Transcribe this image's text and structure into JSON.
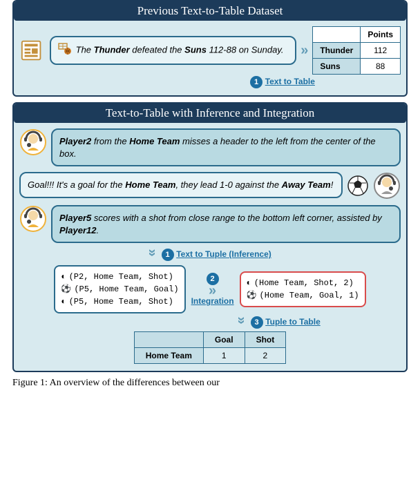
{
  "top": {
    "header": "Previous Text-to-Table Dataset",
    "speech_parts": [
      "The ",
      "Thunder",
      " defeated the ",
      "Suns",
      " 112-88 on Sunday."
    ],
    "table": {
      "col": "Points",
      "rows": [
        {
          "team": "Thunder",
          "pts": "112"
        },
        {
          "team": "Suns",
          "pts": "88"
        }
      ]
    },
    "step_num": "1",
    "step_label": "Text to Table"
  },
  "bottom": {
    "header": "Text-to-Table with Inference and Integration",
    "c1": [
      "Player2",
      " from the ",
      "Home Team",
      " misses a header to the left from the center of the box."
    ],
    "c2": [
      "Goal!!! It's a goal for the ",
      "Home Team",
      ", they lead 1-0 against the ",
      "Away Team",
      "!"
    ],
    "c3": [
      "Player5",
      " scores with a shot from close range to the bottom left corner, assisted by ",
      "Player12",
      "."
    ],
    "step1": {
      "num": "1",
      "label": "Text to Tuple (Inference)"
    },
    "step2": {
      "num": "2",
      "label": "Integration"
    },
    "step3": {
      "num": "3",
      "label": "Tuple to Table"
    },
    "tuples_left": [
      "(P2,   Home Team, Shot)",
      "(P5,   Home Team, Goal)",
      "(P5,   Home Team, Shot)"
    ],
    "tuples_right": [
      "(Home Team, Shot, 2)",
      "(Home Team, Goal, 1)"
    ],
    "table": {
      "cols": [
        "Goal",
        "Shot"
      ],
      "row_label": "Home Team",
      "vals": [
        "1",
        "2"
      ]
    }
  },
  "caption": "Figure 1: An overview of the differences between our"
}
